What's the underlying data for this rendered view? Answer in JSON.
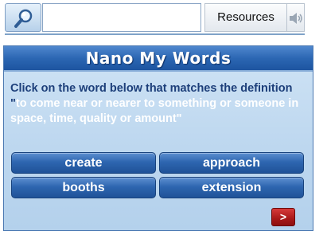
{
  "toolbar": {
    "search_icon": "magnifier-icon",
    "search_value": "",
    "resources_label": "Resources",
    "sound_icon": "speaker-icon"
  },
  "game": {
    "title": "Nano My Words",
    "prompt_lead": "Click on the word below that matches the definition \"",
    "definition": "to come near or nearer to something or someone in space, time, quality or amount\"",
    "answers": [
      {
        "label": "create"
      },
      {
        "label": "approach"
      },
      {
        "label": "booths"
      },
      {
        "label": "extension"
      }
    ],
    "next_label": ">"
  },
  "colors": {
    "header_blue": "#2c67b3",
    "panel_bg": "#c4dcf2",
    "button_blue": "#2e66b0",
    "prompt_text": "#1d3f7a",
    "next_red": "#a81818"
  }
}
